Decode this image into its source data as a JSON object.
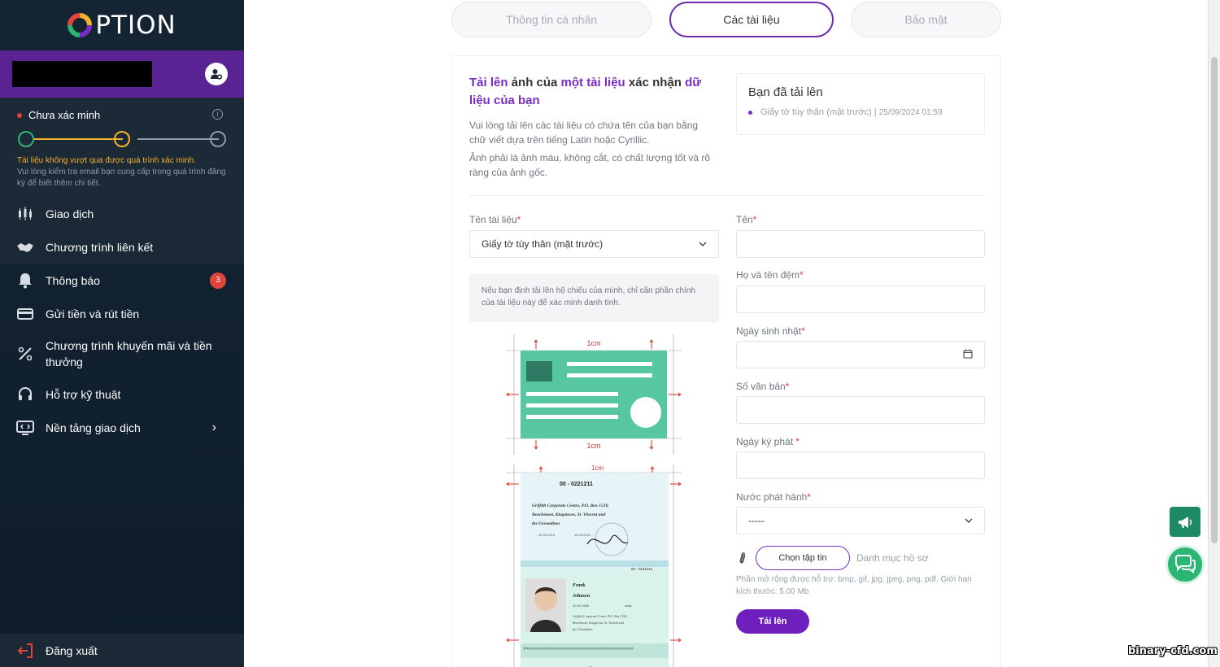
{
  "brand": {
    "logo_text": "PTION"
  },
  "verification": {
    "status": "Chưa xác minh",
    "warning": "Tài liệu không vượt qua được quá trình xác minh.",
    "note": "Vui lòng kiểm tra email bạn cung cấp trong quá trình đăng ký để biết thêm chi tiết.",
    "colors": {
      "done": "#2bb673",
      "current": "#f5b129",
      "pending": "#8d9aa8"
    }
  },
  "menu": {
    "trading": "Giao dịch",
    "affiliate": "Chương trình liên kết",
    "notifications": "Thông báo",
    "notifications_badge": "3",
    "deposit_withdraw": "Gửi tiền và rút tiền",
    "promotions": "Chương trình khuyến mãi và tiền thưởng",
    "support": "Hỗ trợ kỹ thuật",
    "platforms": "Nền tảng giao dịch",
    "logout": "Đăng xuất"
  },
  "tabs": {
    "personal": "Thông tin cá nhân",
    "documents": "Các tài liệu",
    "security": "Bảo mật"
  },
  "intro": {
    "title_1": "Tải lên",
    "title_2": " ảnh của ",
    "title_3": "một tài liệu",
    "title_4": " xác nhận ",
    "title_5": "dữ liệu của bạn",
    "p1": "Vui lòng tải lên các tài liệu có chứa tên của bạn bằng chữ viết dựa trên tiếng Latin hoặc Cyrillic.",
    "p2": "Ảnh phải là ảnh màu, không cắt, có chất lượng tốt và rõ ràng của ảnh gốc."
  },
  "uploaded": {
    "title": "Bạn đã tải lên",
    "item_name": "Giấy tờ tùy thân (mặt trước) |",
    "item_date": "25/09/2024 01:59"
  },
  "form": {
    "doc_name_label": "Tên tài liệu",
    "doc_name_value": "Giấy tờ tùy thân (mặt trước)",
    "first_name_label": "Tên",
    "last_name_label": "Họ và tên đệm",
    "birthday_label": "Ngày sinh nhật",
    "doc_number_label": "Số văn bản",
    "issue_date_label": "Ngày ký phát ",
    "country_label": "Nước phát hành",
    "country_value": "-----",
    "required_mark": "*",
    "passport_note": "Nếu bạn định tải lên hộ chiếu của mình, chỉ cần phần chính của tài liệu này để xác minh danh tính.",
    "choose_file": "Chọn tập tin",
    "file_directory": "Danh mục hồ sơ",
    "extensions_note": "Phần mở rộng được hỗ trợ: bmp, gif, jpg, jpeg, png, pdf. Giới hạn kích thước: 5.00 Mb",
    "upload_button": "Tải lên"
  },
  "sample": {
    "margin_label": "1cm",
    "passport_number": "00 - 0221211",
    "address_1": "Griffith Corporate Centre, P.O. Box 1510,",
    "address_2": "Beachmont, Kingstown, St. Vincent and",
    "address_3": "the Grenadines",
    "date_1": "10.09.2013",
    "date_2": "16.09.2023",
    "holder_first": "Frank",
    "holder_last": "Johnson",
    "holder_dob": "10.02.1980",
    "holder_sex": "male",
    "mrz": "P<<<<<<<<<<<<<<<<<<<<<<<<<<<<<<<<<<<<<<<<<<<<",
    "id_color": "#56c7a1"
  },
  "watermark": "binary-cfd.com"
}
